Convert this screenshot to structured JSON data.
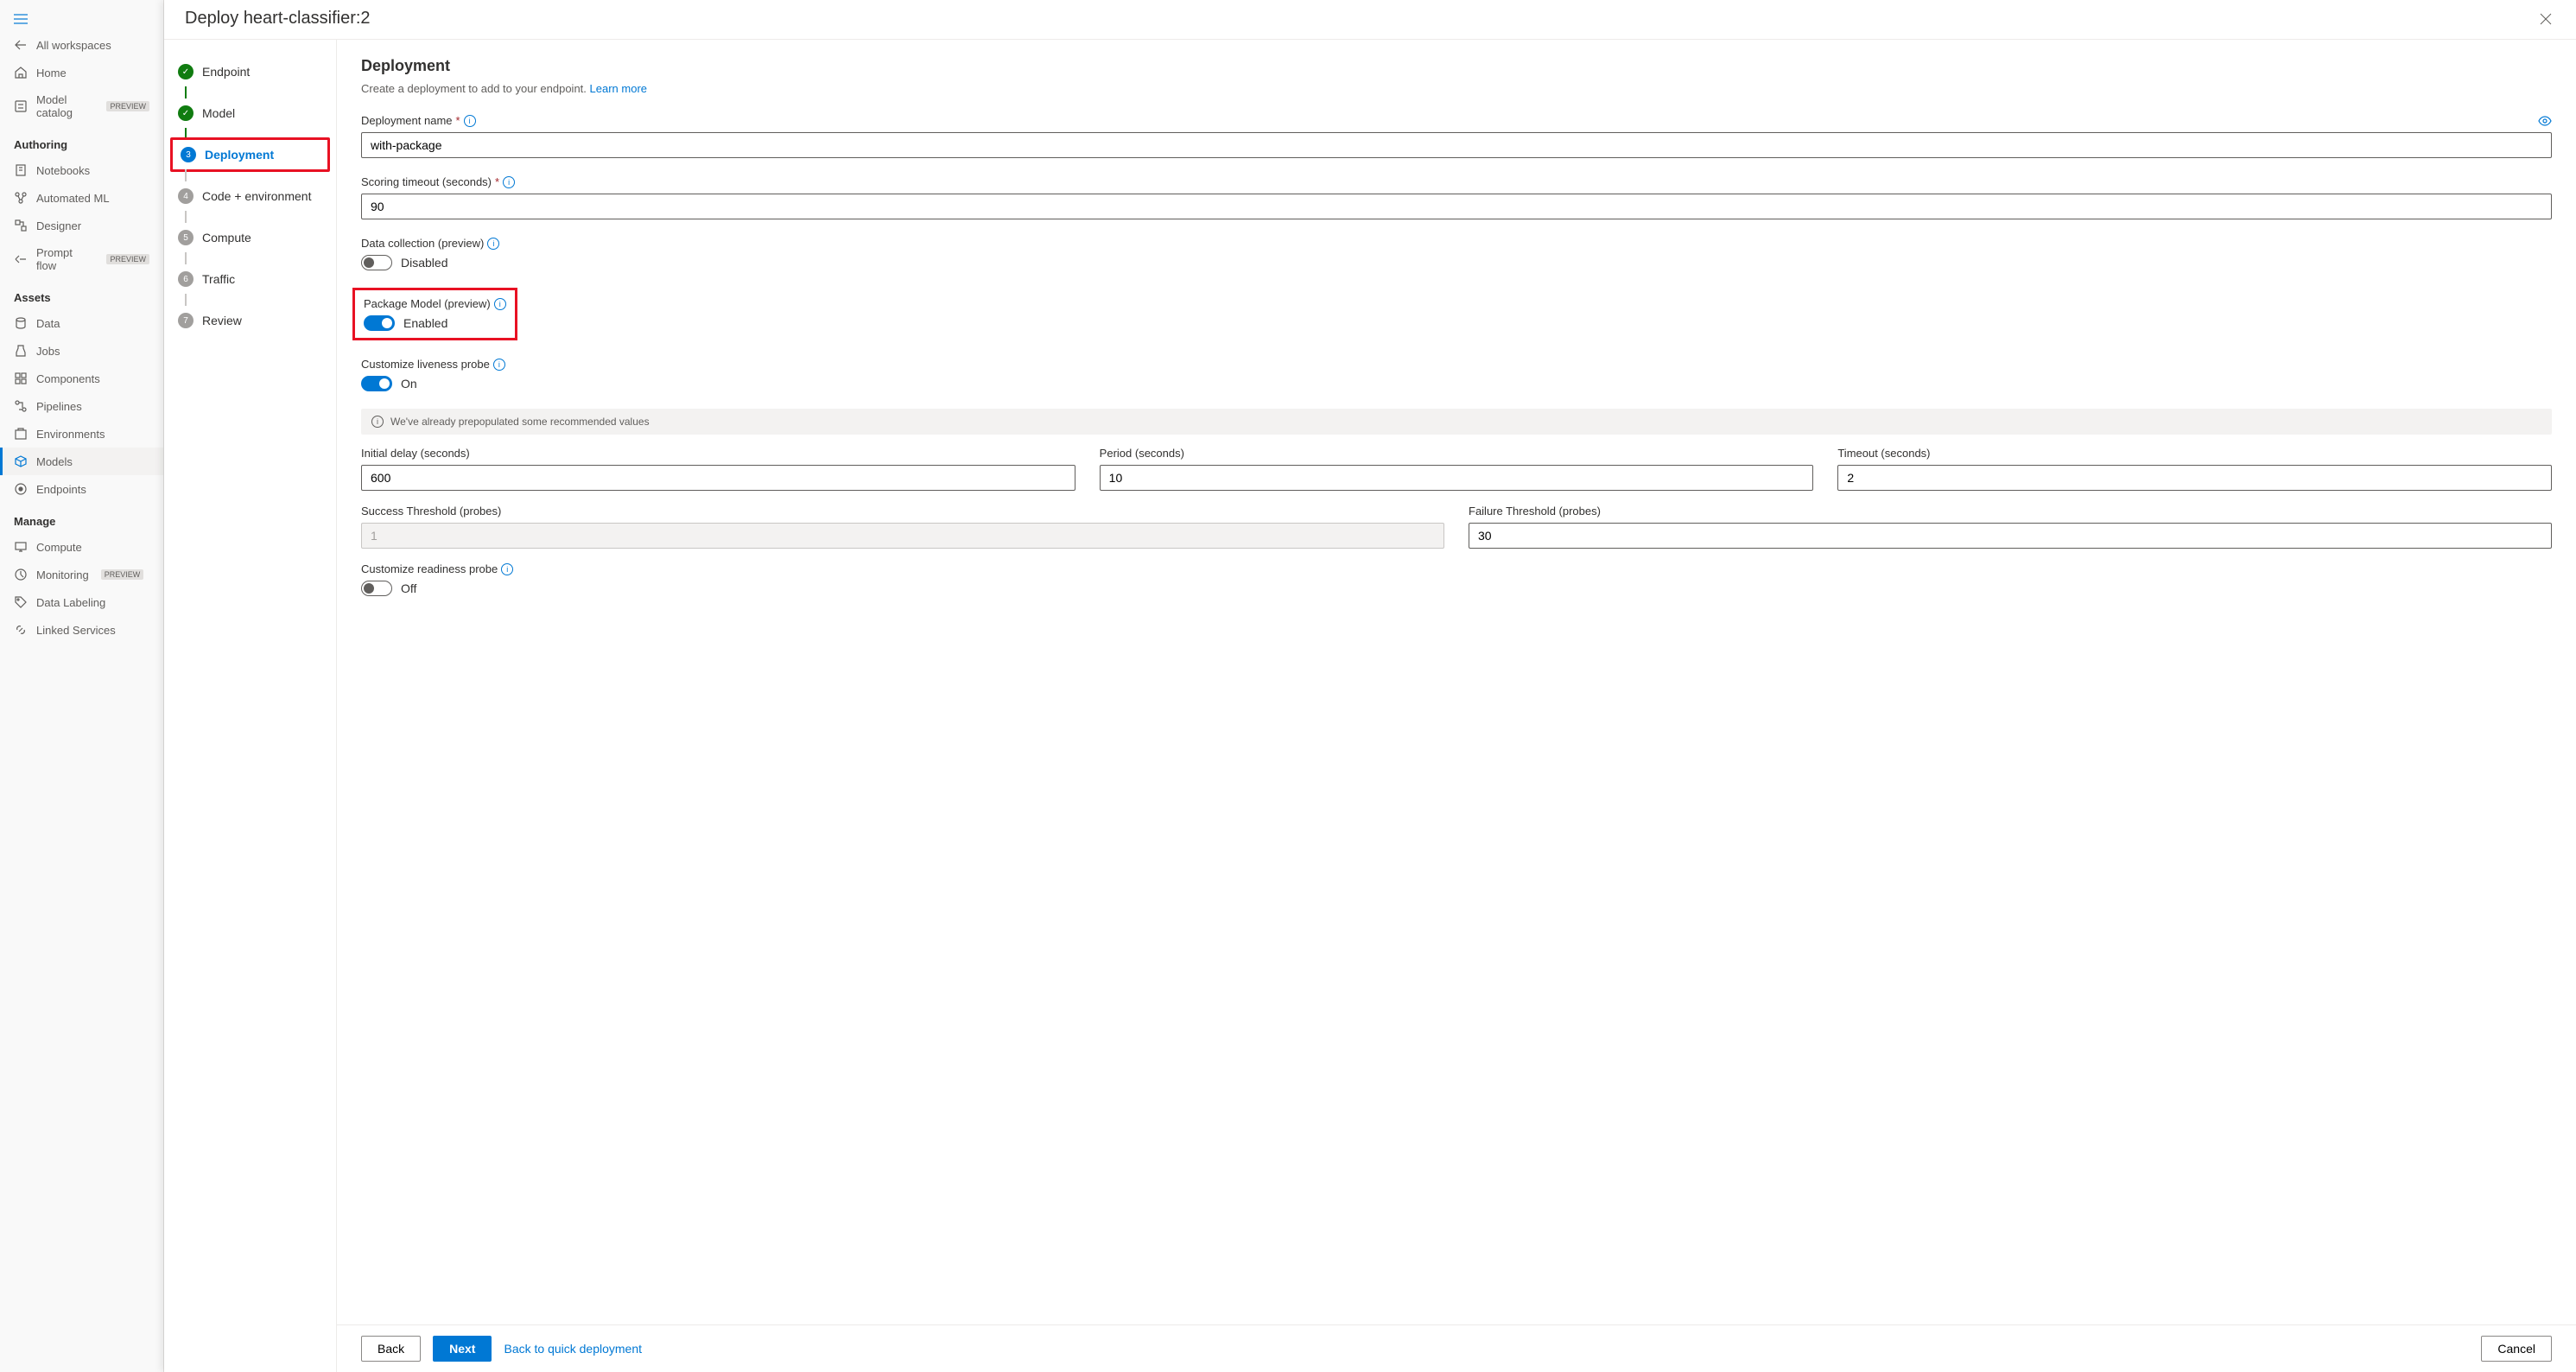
{
  "sidebar": {
    "allWorkspaces": "All workspaces",
    "home": "Home",
    "modelCatalog": "Model catalog",
    "previewBadge": "PREVIEW",
    "authoring": "Authoring",
    "notebooks": "Notebooks",
    "automatedML": "Automated ML",
    "designer": "Designer",
    "promptFlow": "Prompt flow",
    "assets": "Assets",
    "data": "Data",
    "jobs": "Jobs",
    "components": "Components",
    "pipelines": "Pipelines",
    "environments": "Environments",
    "models": "Models",
    "endpoints": "Endpoints",
    "manage": "Manage",
    "compute": "Compute",
    "monitoring": "Monitoring",
    "dataLabeling": "Data Labeling",
    "linkedServices": "Linked Services"
  },
  "panel": {
    "title": "Deploy heart-classifier:2"
  },
  "wizard": {
    "steps": [
      {
        "label": "Endpoint"
      },
      {
        "label": "Model"
      },
      {
        "label": "Deployment"
      },
      {
        "label": "Code + environment"
      },
      {
        "label": "Compute"
      },
      {
        "label": "Traffic"
      },
      {
        "label": "Review"
      }
    ]
  },
  "form": {
    "title": "Deployment",
    "desc": "Create a deployment to add to your endpoint.",
    "learnMore": "Learn more",
    "deploymentName": {
      "label": "Deployment name",
      "value": "with-package"
    },
    "scoringTimeout": {
      "label": "Scoring timeout (seconds)",
      "value": "90"
    },
    "dataCollection": {
      "label": "Data collection (preview)",
      "state": "Disabled"
    },
    "packageModel": {
      "label": "Package Model (preview)",
      "state": "Enabled"
    },
    "livenessProbe": {
      "label": "Customize liveness probe",
      "state": "On"
    },
    "banner": "We've already prepopulated some recommended values",
    "initialDelay": {
      "label": "Initial delay (seconds)",
      "value": "600"
    },
    "period": {
      "label": "Period (seconds)",
      "value": "10"
    },
    "timeout": {
      "label": "Timeout (seconds)",
      "value": "2"
    },
    "successThreshold": {
      "label": "Success Threshold (probes)",
      "value": "1"
    },
    "failureThreshold": {
      "label": "Failure Threshold (probes)",
      "value": "30"
    },
    "readinessProbe": {
      "label": "Customize readiness probe",
      "state": "Off"
    }
  },
  "footer": {
    "back": "Back",
    "next": "Next",
    "quickDeploy": "Back to quick deployment",
    "cancel": "Cancel"
  }
}
